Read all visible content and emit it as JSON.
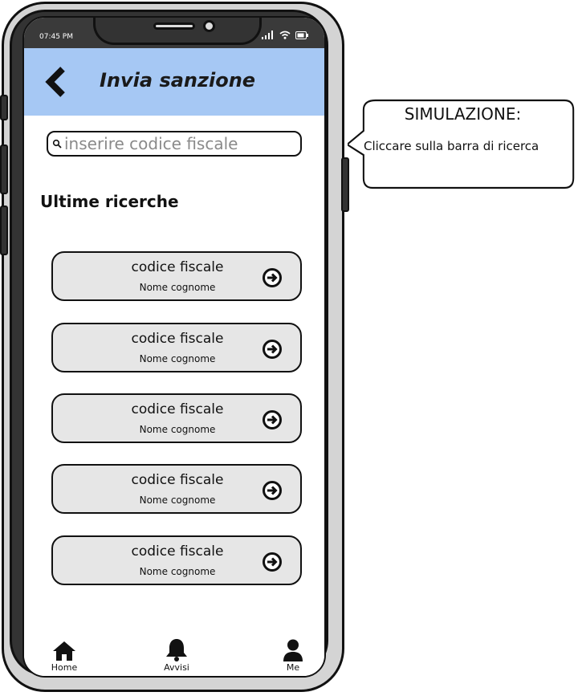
{
  "status_bar": {
    "time": "07:45 PM"
  },
  "header": {
    "title": "Invia sanzione",
    "back_icon": "chevron-left-icon"
  },
  "search": {
    "placeholder": "inserire codice fiscale",
    "icon": "search-icon"
  },
  "recent": {
    "title": "Ultime ricerche",
    "items": [
      {
        "code": "codice fiscale",
        "name": "Nome cognome"
      },
      {
        "code": "codice fiscale",
        "name": "Nome cognome"
      },
      {
        "code": "codice fiscale",
        "name": "Nome cognome"
      },
      {
        "code": "codice fiscale",
        "name": "Nome cognome"
      },
      {
        "code": "codice fiscale",
        "name": "Nome cognome"
      }
    ]
  },
  "tabbar": {
    "items": [
      {
        "label": "Home",
        "icon": "home-icon"
      },
      {
        "label": "Avvisi",
        "icon": "bell-icon"
      },
      {
        "label": "Me",
        "icon": "user-icon"
      }
    ]
  },
  "callout": {
    "title": "SIMULAZIONE:",
    "text": "Cliccare sulla barra di ricerca"
  },
  "colors": {
    "header_bg": "#a6c8f4",
    "item_bg": "#e6e6e6",
    "phone_frame": "#333333"
  }
}
